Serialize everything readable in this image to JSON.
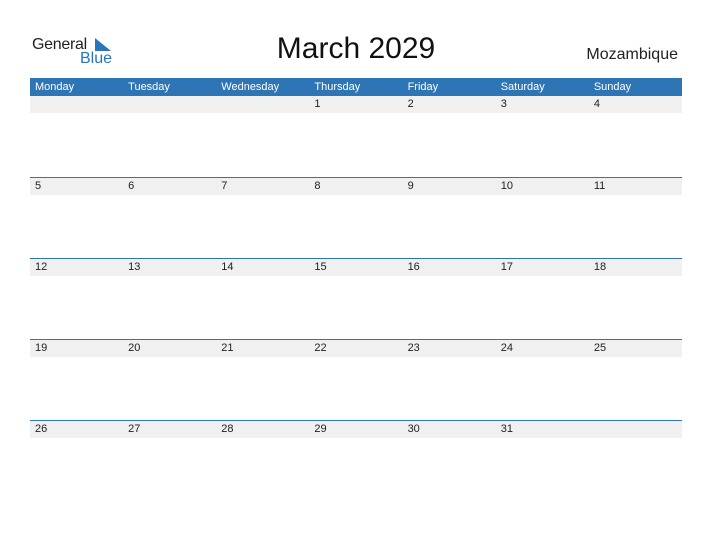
{
  "logo": {
    "general": "General",
    "blue": "Blue"
  },
  "title": "March 2029",
  "country": "Mozambique",
  "colors": {
    "accent": "#2e75b6",
    "band": "#f0f0f0"
  },
  "days": [
    "Monday",
    "Tuesday",
    "Wednesday",
    "Thursday",
    "Friday",
    "Saturday",
    "Sunday"
  ],
  "weeks": [
    [
      "",
      "",
      "",
      "1",
      "2",
      "3",
      "4"
    ],
    [
      "5",
      "6",
      "7",
      "8",
      "9",
      "10",
      "11"
    ],
    [
      "12",
      "13",
      "14",
      "15",
      "16",
      "17",
      "18"
    ],
    [
      "19",
      "20",
      "21",
      "22",
      "23",
      "24",
      "25"
    ],
    [
      "26",
      "27",
      "28",
      "29",
      "30",
      "31",
      ""
    ]
  ]
}
